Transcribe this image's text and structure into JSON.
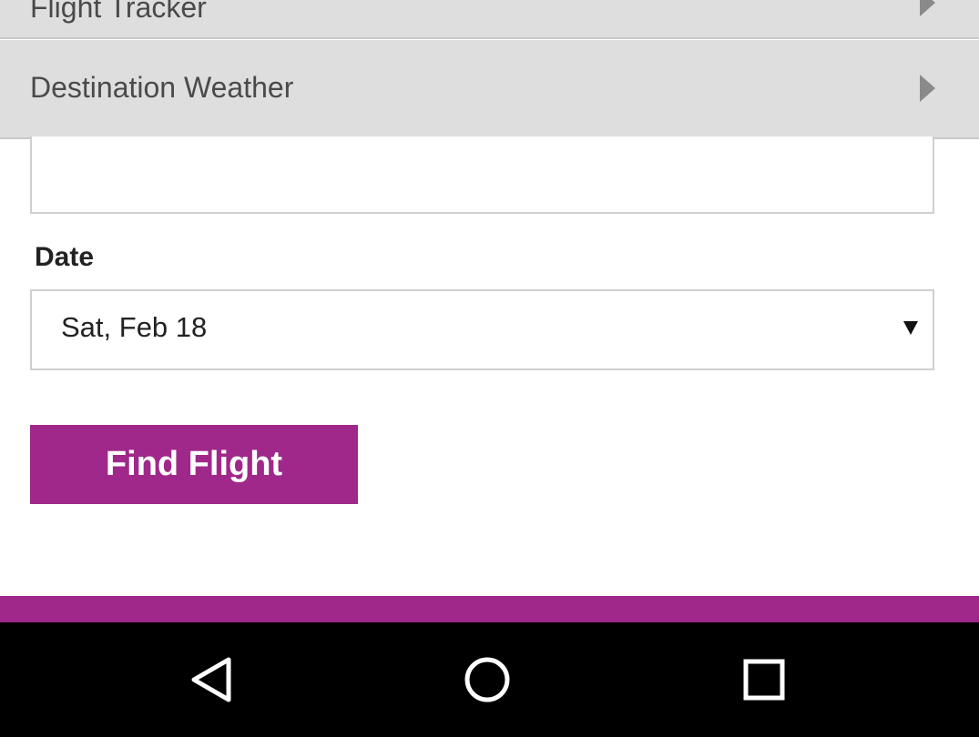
{
  "accordion": {
    "items": [
      {
        "label": "Flight Tracker"
      },
      {
        "label": "Destination Weather"
      }
    ]
  },
  "form": {
    "text_field_value": "",
    "date_label": "Date",
    "date_value": "Sat, Feb 18",
    "find_button_label": "Find Flight"
  },
  "icons": {
    "accordion_arrow": "chevron-right-icon",
    "select_caret": "caret-down-icon",
    "nav_back": "back-triangle-icon",
    "nav_home": "home-circle-icon",
    "nav_recents": "recents-square-icon"
  },
  "colors": {
    "accent": "#a0288a",
    "accordion_bg": "#dedede",
    "nav_bg": "#000000"
  }
}
